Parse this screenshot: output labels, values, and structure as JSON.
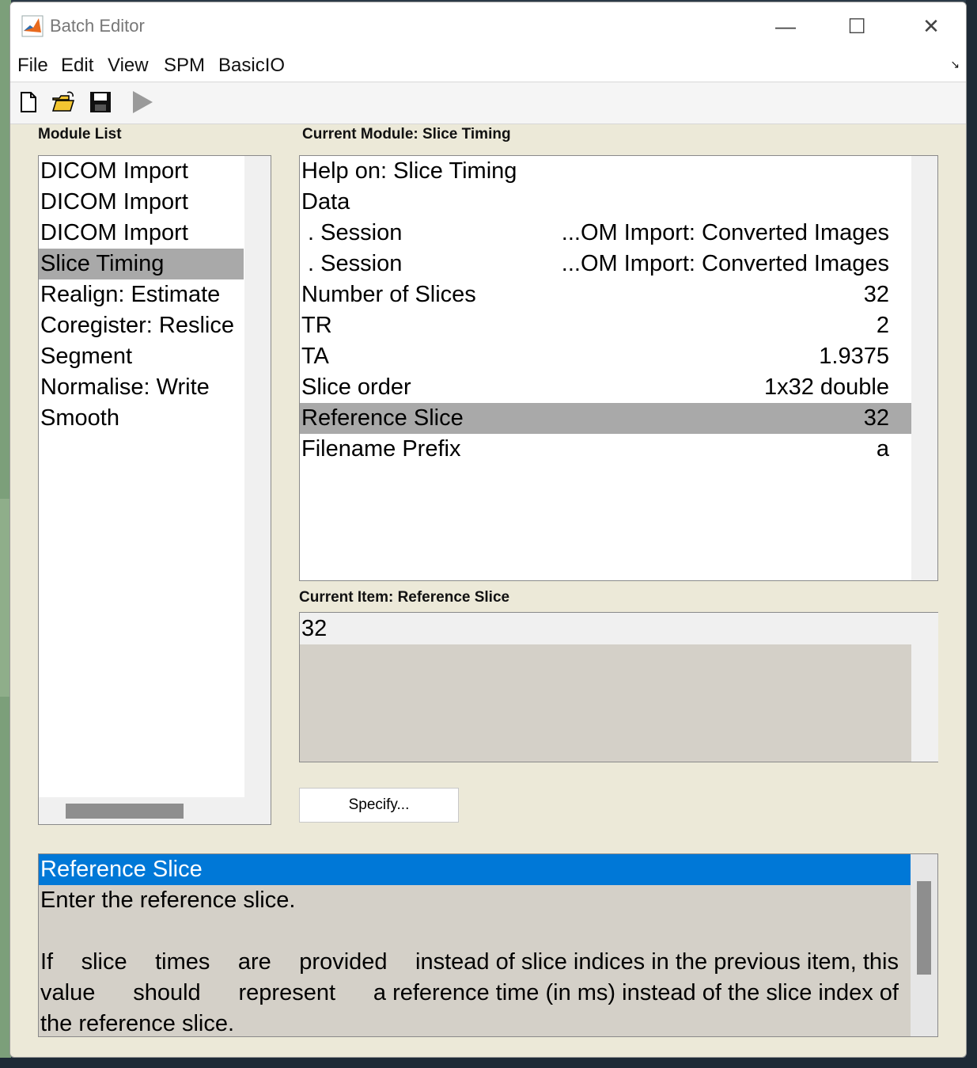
{
  "window": {
    "title": "Batch Editor",
    "minimize_glyph": "—",
    "maximize_glyph": "☐",
    "close_glyph": "✕"
  },
  "menu": {
    "items": [
      "File",
      "Edit",
      "View",
      "SPM",
      "BasicIO"
    ],
    "corner_glyph": "↘"
  },
  "toolbar": {
    "icons": [
      "new-file-icon",
      "open-folder-icon",
      "save-icon",
      "run-icon"
    ]
  },
  "module_list": {
    "label": "Module List",
    "items": [
      "DICOM Import",
      "DICOM Import",
      "DICOM Import",
      "Slice Timing",
      "Realign: Estimate",
      "Coregister: Reslice",
      "Segment",
      "Normalise: Write",
      "Smooth"
    ],
    "selected_index": 3
  },
  "current_module": {
    "label": "Current Module: Slice Timing",
    "rows": [
      {
        "name": "Help on: Slice Timing",
        "value": ""
      },
      {
        "name": "Data",
        "value": ""
      },
      {
        "name": " . Session",
        "value": "...OM Import: Converted Images"
      },
      {
        "name": " . Session",
        "value": "...OM Import: Converted Images"
      },
      {
        "name": "Number of Slices",
        "value": "32"
      },
      {
        "name": "TR",
        "value": "2"
      },
      {
        "name": "TA",
        "value": "1.9375"
      },
      {
        "name": "Slice order",
        "value": "1x32 double"
      },
      {
        "name": "Reference Slice",
        "value": "32"
      },
      {
        "name": "Filename Prefix",
        "value": "a"
      }
    ],
    "selected_index": 8
  },
  "current_item": {
    "label": "Current Item: Reference Slice",
    "value": "32"
  },
  "specify_button": "Specify...",
  "help": {
    "title": "Reference Slice",
    "line1": "Enter the reference slice.",
    "para_line1_words": [
      "If",
      "slice",
      "times",
      "are",
      "provided",
      "instead of slice indices in the previous item, this"
    ],
    "para_line2_words": [
      "value",
      "should",
      "represent",
      "a reference time (in ms) instead of the slice index of"
    ],
    "para_line3": "the reference slice."
  }
}
